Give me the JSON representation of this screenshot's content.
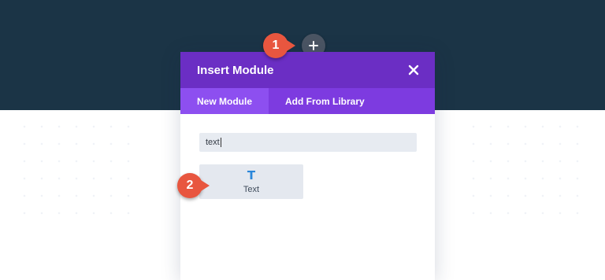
{
  "modal": {
    "title": "Insert Module",
    "tabs": [
      {
        "label": "New Module",
        "active": true
      },
      {
        "label": "Add From Library",
        "active": false
      }
    ],
    "search": {
      "value": "text"
    },
    "modules": [
      {
        "label": "Text",
        "icon": "text-T-icon"
      }
    ]
  },
  "callouts": [
    {
      "number": "1"
    },
    {
      "number": "2"
    }
  ],
  "colors": {
    "header_bg": "#1b3446",
    "modal_header": "#6b2ec4",
    "tab_bar": "#7d3be0",
    "active_tab": "#8d4ff0",
    "callout": "#e8563f",
    "icon_blue": "#2b87da"
  }
}
